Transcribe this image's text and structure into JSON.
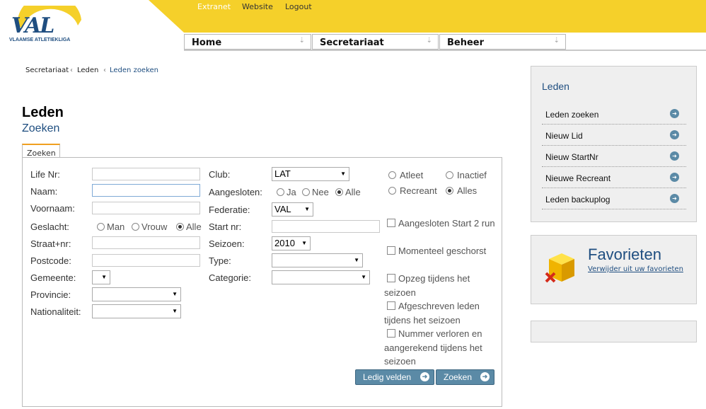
{
  "header": {
    "brand": "VAL",
    "brand_sub": "VLAAMSE ATLETIEKLIGA",
    "top_links": [
      "Extranet",
      "Website",
      "Logout"
    ],
    "nav": [
      "Home",
      "Secretariaat",
      "Beheer"
    ],
    "accent_color": "#f5d02a"
  },
  "breadcrumb": [
    "Secretariaat",
    "Leden",
    "Leden zoeken"
  ],
  "page": {
    "title": "Leden",
    "subtitle": "Zoeken",
    "tab": "Zoeken"
  },
  "form": {
    "col1": {
      "life_nr": "Life Nr:",
      "naam": "Naam:",
      "voornaam": "Voornaam:",
      "geslacht": "Geslacht:",
      "geslacht_options": [
        "Man",
        "Vrouw",
        "Alle"
      ],
      "straat": "Straat+nr:",
      "postcode": "Postcode:",
      "gemeente": "Gemeente:",
      "provincie": "Provincie:",
      "nationaliteit": "Nationaliteit:"
    },
    "col2": {
      "club": "Club:",
      "club_value": "LAT",
      "aangesloten": "Aangesloten:",
      "aangesloten_options": [
        "Ja",
        "Nee",
        "Alle"
      ],
      "federatie": "Federatie:",
      "federatie_value": "VAL",
      "start_nr": "Start nr:",
      "seizoen": "Seizoen:",
      "seizoen_value": "2010",
      "type": "Type:",
      "categorie": "Categorie:"
    },
    "col3": {
      "status_options": [
        "Atleet",
        "Inactief",
        "Recreant",
        "Alles"
      ],
      "checkboxes": [
        "Aangesloten Start 2 run",
        "Momenteel geschorst",
        "Opzeg tijdens het seizoen",
        "Afgeschreven leden tijdens het seizoen",
        "Nummer verloren en aangerekend tijdens het seizoen"
      ]
    },
    "buttons": {
      "clear": "Ledig velden",
      "search": "Zoeken"
    }
  },
  "sidebar": {
    "title": "Leden",
    "items": [
      "Leden zoeken",
      "Nieuw Lid",
      "Nieuw StartNr",
      "Nieuwe Recreant",
      "Leden backuplog"
    ]
  },
  "favorites": {
    "title": "Favorieten",
    "link": "Verwijder uit uw favorieten"
  }
}
